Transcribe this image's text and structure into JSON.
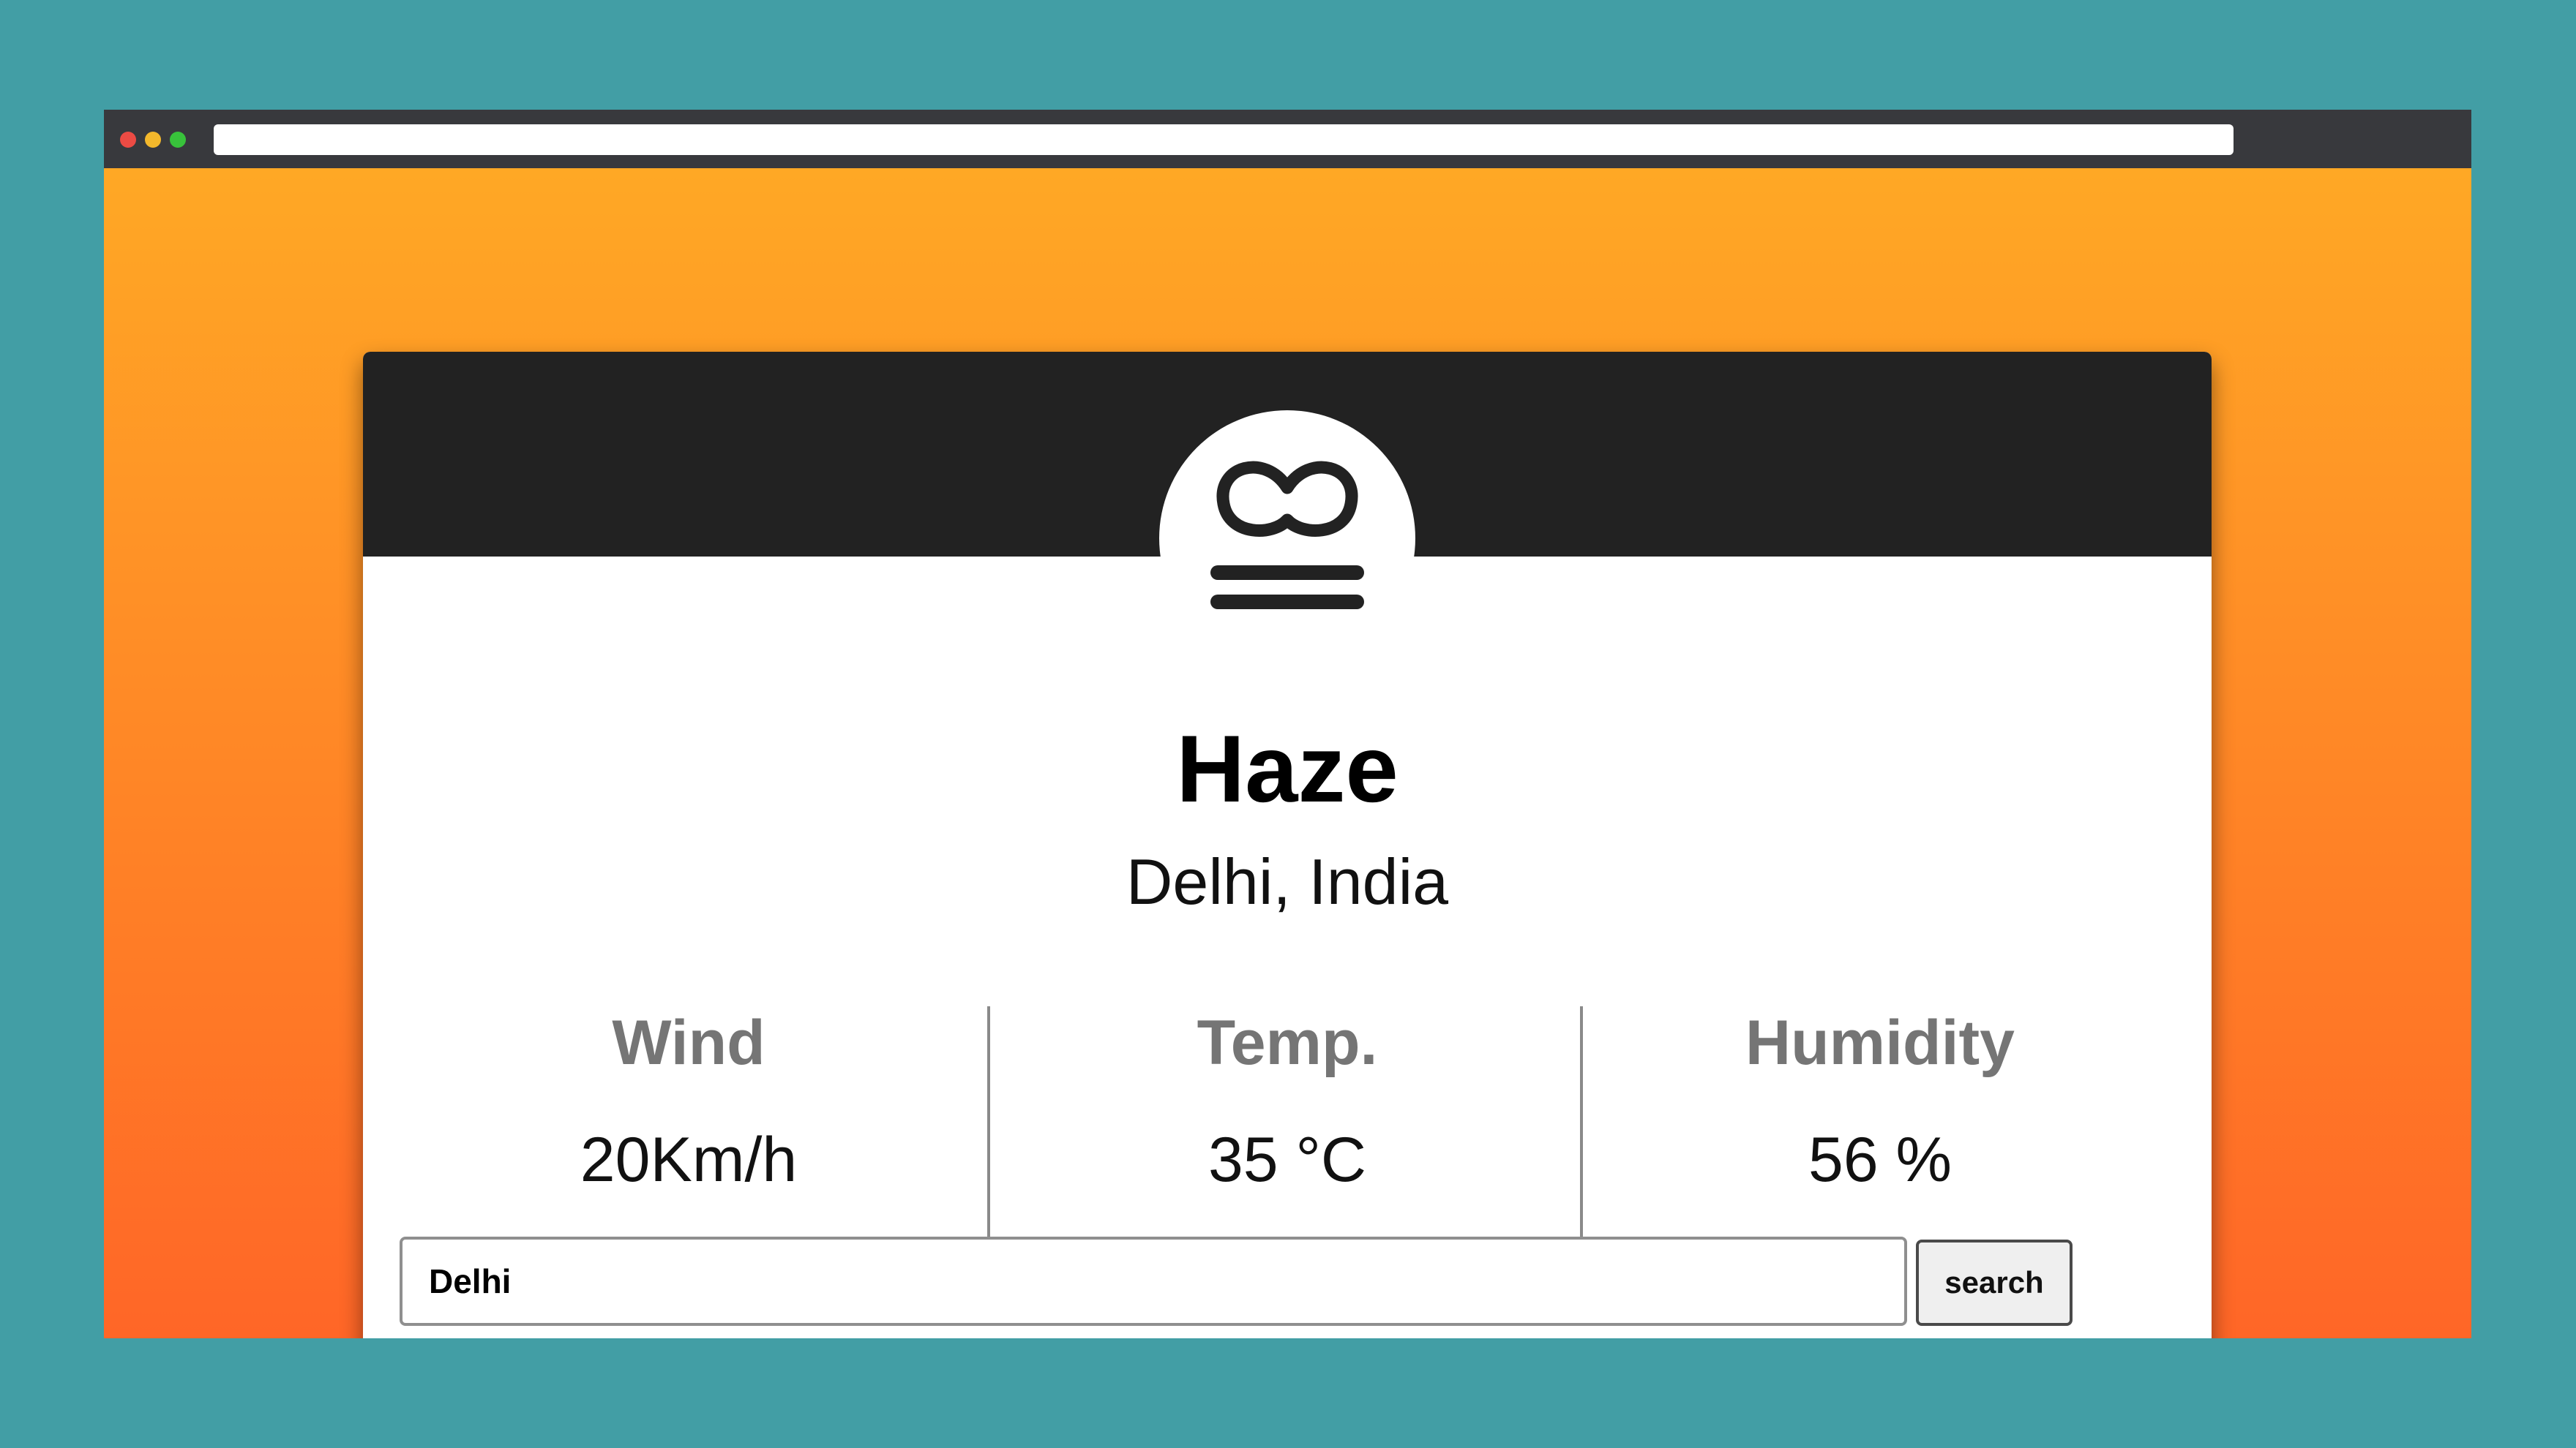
{
  "colors": {
    "page_background": "#429ea5",
    "browser_titlebar": "#38393d",
    "gradient_top": "#ffa825",
    "gradient_bottom": "#ff6627",
    "card_header": "#222222",
    "traffic_red": "#ec4b44",
    "traffic_yellow": "#f3b82c",
    "traffic_green": "#38c23b"
  },
  "weather": {
    "icon": "haze-icon",
    "condition": "Haze",
    "location": "Delhi, India",
    "stats": [
      {
        "label": "Wind",
        "value": "20Km/h"
      },
      {
        "label": "Temp.",
        "value": "35 °C"
      },
      {
        "label": "Humidity",
        "value": "56 %"
      }
    ]
  },
  "search": {
    "input_value": "Delhi",
    "button_label": "search"
  }
}
